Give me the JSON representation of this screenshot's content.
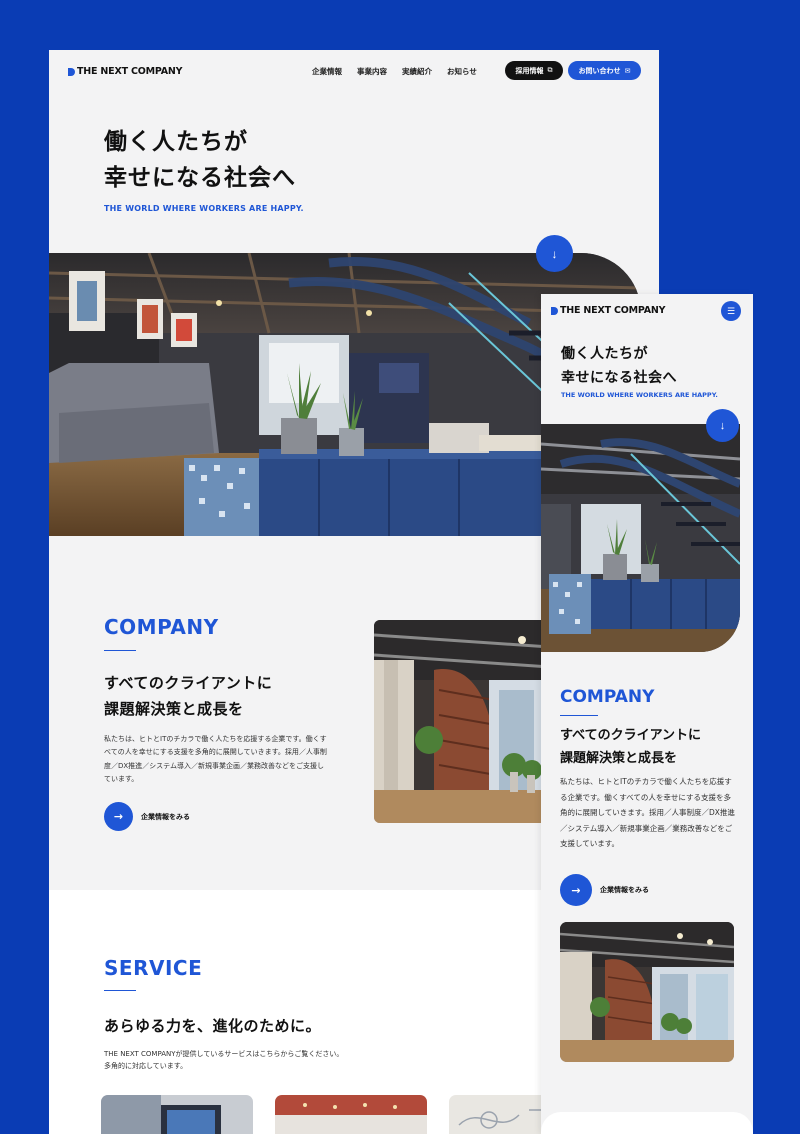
{
  "brand": {
    "logo_text": "THE NEXT COMPANY",
    "accent": "#1f56d6",
    "background": "#0a3cb4"
  },
  "desktop": {
    "nav": [
      "企業情報",
      "事業内容",
      "実績紹介",
      "お知らせ"
    ],
    "recruit_button": "採用情報",
    "contact_button": "お問い合わせ",
    "hero": {
      "title_line1": "働く人たちが",
      "title_line2": "幸せになる社会へ",
      "subtitle": "THE WORLD WHERE WORKERS ARE HAPPY.",
      "scroll_icon": "↓"
    },
    "company": {
      "title": "COMPANY",
      "heading_line1": "すべてのクライアントに",
      "heading_line2": "課題解決策と成長を",
      "body": "私たちは、ヒトとITのチカラで働く人たちを応援する企業です。働くすべての人を幸せにする支援を多角的に展開していきます。採用／人事制度／DX推進／システム導入／新規事業企画／業務改善などをご支援しています。",
      "more_label": "企業情報をみる",
      "more_icon": "→"
    },
    "service": {
      "title": "SERVICE",
      "heading": "あらゆる力を、進化のために。",
      "body_line1": "THE NEXT COMPANYが提供しているサービスはこちらからご覧ください。",
      "body_line2": "多角的に対応しています。"
    }
  },
  "mobile": {
    "menu_icon": "☰",
    "hero": {
      "title_line1": "働く人たちが",
      "title_line2": "幸せになる社会へ",
      "subtitle": "THE WORLD WHERE WORKERS ARE HAPPY.",
      "scroll_icon": "↓"
    },
    "company": {
      "title": "COMPANY",
      "heading_line1": "すべてのクライアントに",
      "heading_line2": "課題解決策と成長を",
      "body": "私たちは、ヒトとITのチカラで働く人たちを応援する企業です。働くすべての人を幸せにする支援を多角的に展開していきます。採用／人事制度／DX推進／システム導入／新規事業企画／業務改善などをご支援しています。",
      "more_label": "企業情報をみる",
      "more_icon": "→"
    }
  }
}
